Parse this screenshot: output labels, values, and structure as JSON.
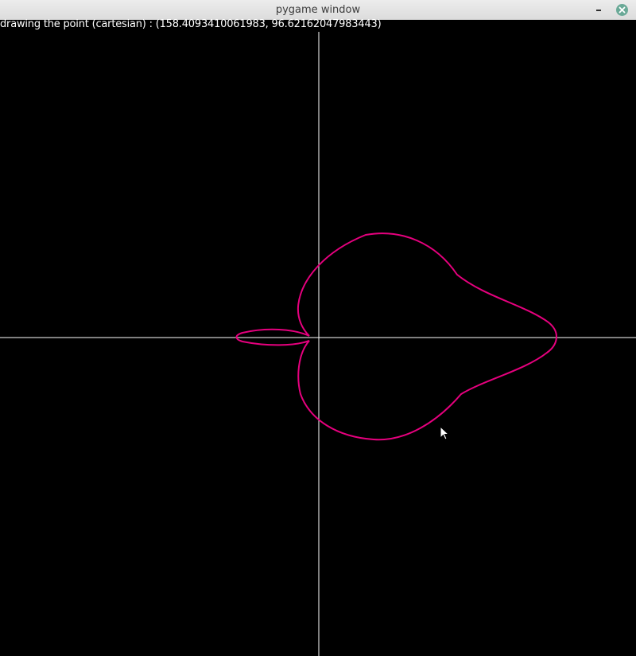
{
  "window": {
    "title": "pygame window",
    "titlebar_color": "#e4e4e4",
    "close_button_color": "#6aa997",
    "minimize_icon": "minimize-icon",
    "close_icon": "close-icon"
  },
  "canvas": {
    "background": "#000000",
    "axis_color": "#ffffff",
    "curve_color": "#e6007e",
    "status_text": "drawing the point (cartesian) : (158.4093410061983, 96.62162047983443)"
  },
  "cursor": {
    "icon": "mouse-pointer-icon"
  }
}
